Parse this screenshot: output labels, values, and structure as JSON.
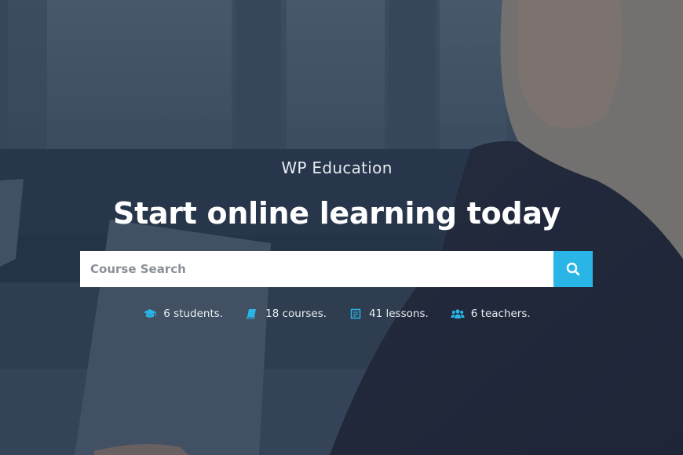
{
  "hero": {
    "site_title": "WP Education",
    "headline": "Start online learning today"
  },
  "search": {
    "placeholder": "Course Search",
    "button_icon": "search-icon"
  },
  "stats": [
    {
      "icon": "graduation-cap-icon",
      "label": "6 students."
    },
    {
      "icon": "book-icon",
      "label": "18 courses."
    },
    {
      "icon": "lesson-list-icon",
      "label": "41 lessons."
    },
    {
      "icon": "users-icon",
      "label": "6 teachers."
    }
  ],
  "colors": {
    "accent": "#29b6e6",
    "overlay": "#1e2c40"
  }
}
